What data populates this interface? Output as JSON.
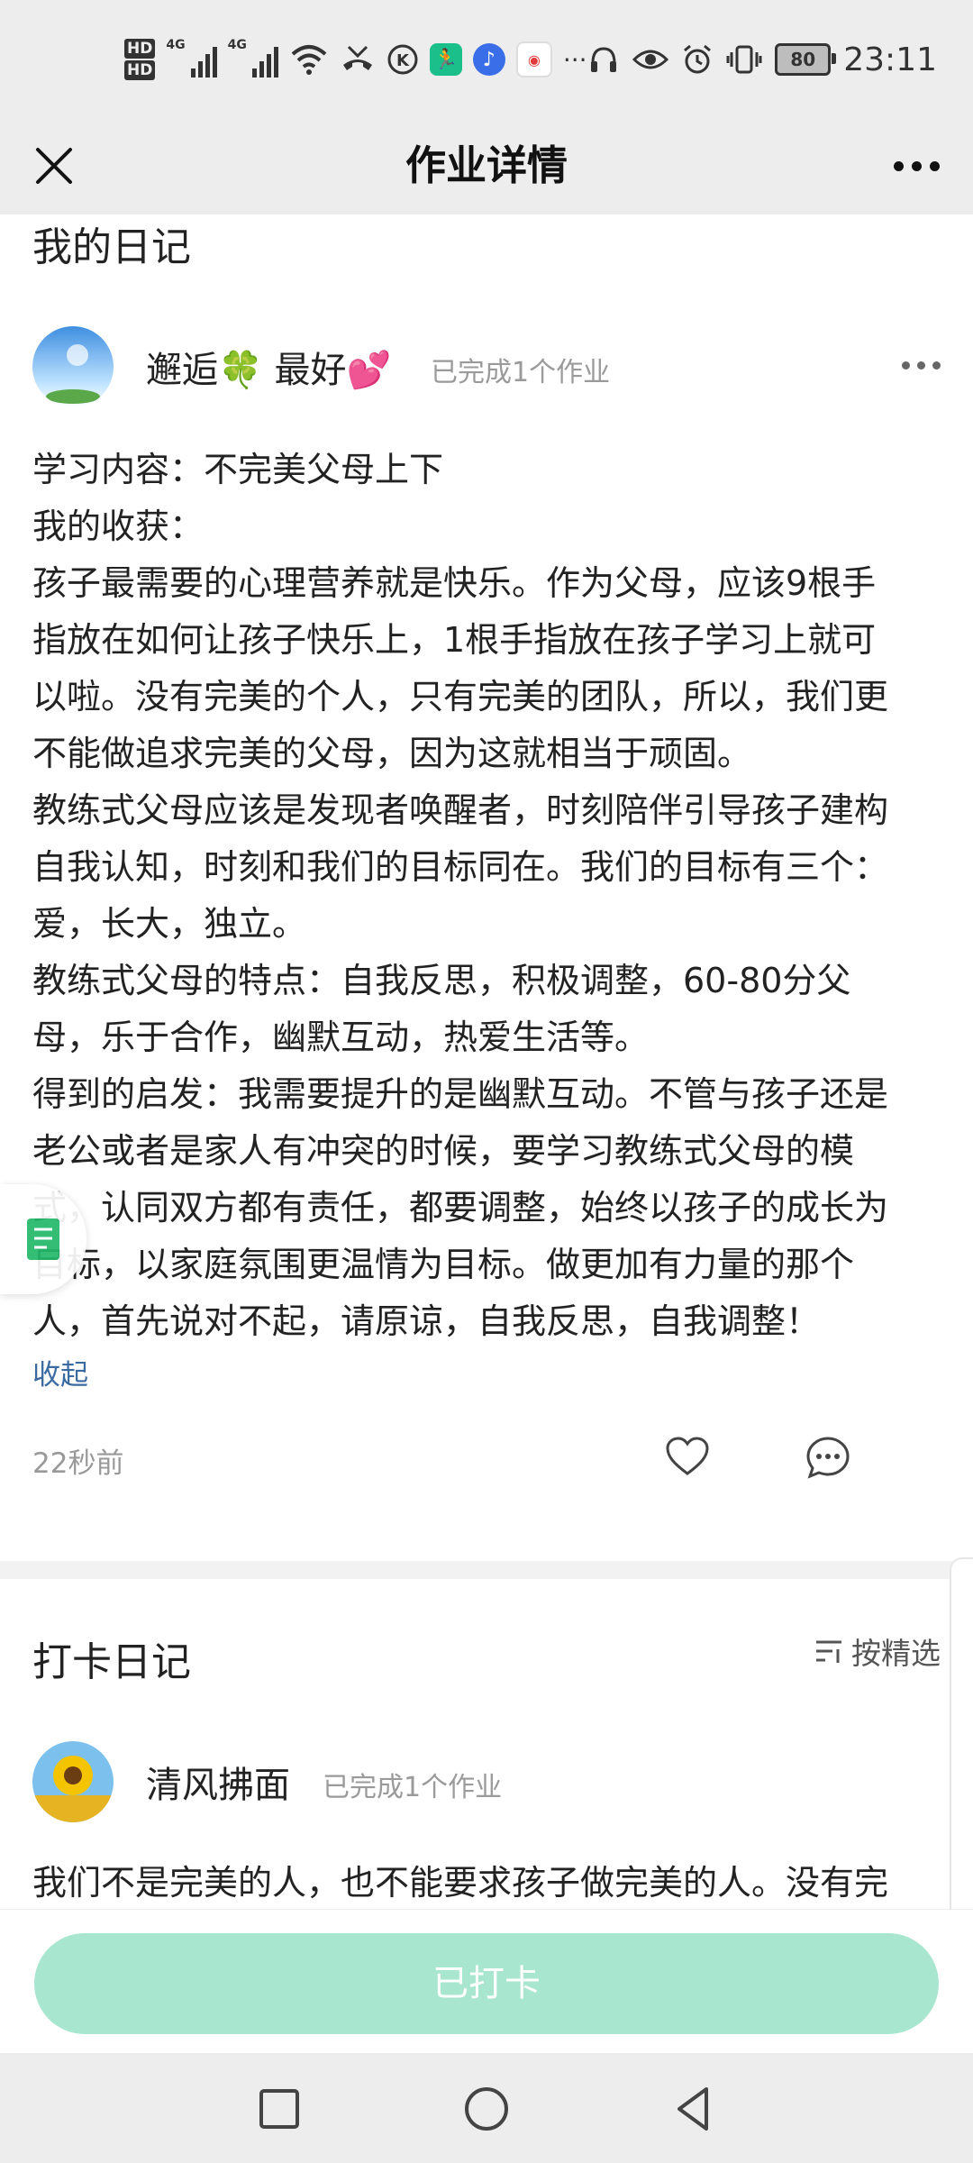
{
  "status_bar": {
    "hd1": "HD",
    "hd2": "HD",
    "net1": "4G",
    "net2": "4G",
    "more": "···",
    "battery": "80",
    "time": "23:11"
  },
  "nav": {
    "title": "作业详情"
  },
  "post": {
    "section_title": "我的日记",
    "user_name": "邂逅🍀 最好💕",
    "user_badge": "已完成1个作业",
    "lines": [
      "学习内容：不完美父母上下",
      "我的收获：",
      "孩子最需要的心理营养就是快乐。作为父母，应该9根手",
      "指放在如何让孩子快乐上，1根手指放在孩子学习上就可",
      "以啦。没有完美的个人，只有完美的团队，所以，我们更",
      "不能做追求完美的父母，因为这就相当于顽固。",
      "教练式父母应该是发现者唤醒者，时刻陪伴引导孩子建构",
      "自我认知，时刻和我们的目标同在。我们的目标有三个：",
      "爱，长大，独立。",
      "教练式父母的特点：自我反思，积极调整，60-80分父",
      "母，乐于合作，幽默互动，热爱生活等。",
      "得到的启发：我需要提升的是幽默互动。不管与孩子还是",
      "老公或者是家人有冲突的时候，要学习教练式父母的模",
      "式，认同双方都有责任，都要调整，始终以孩子的成长为",
      "目标，以家庭氛围更温情为目标。做更加有力量的那个",
      "人，首先说对不起，请原谅，自我反思，自我调整！"
    ],
    "collapse_label": "收起",
    "time_ago": "22秒前"
  },
  "checkin": {
    "section_title": "打卡日记",
    "filter_label": "按精选",
    "entry": {
      "user_name": "清风拂面",
      "user_badge": "已完成1个作业",
      "preview": "我们不是完美的人，也不能要求孩子做完美的人。没有完"
    }
  },
  "bottom": {
    "checkin_button": "已打卡"
  },
  "colors": {
    "accent_button": "#a8e6cf",
    "link": "#3a6aa0",
    "bar_bg": "#ededed"
  }
}
